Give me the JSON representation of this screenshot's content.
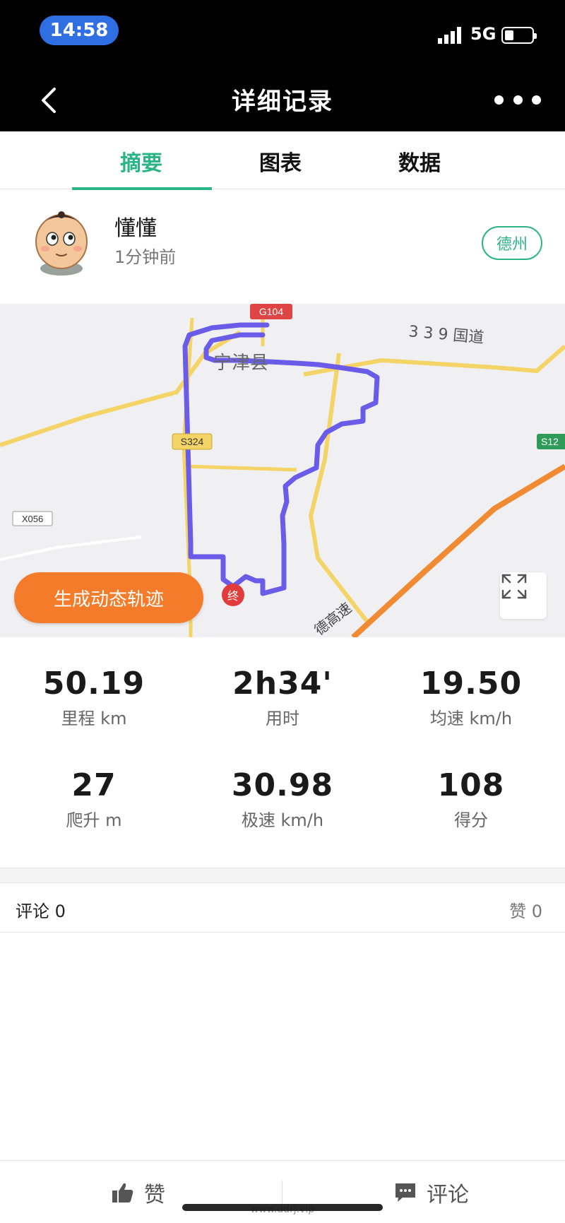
{
  "status_bar": {
    "time": "14:58",
    "network": "5G"
  },
  "header": {
    "title": "详细记录"
  },
  "tabs": [
    {
      "label": "摘要",
      "active": true
    },
    {
      "label": "图表",
      "active": false
    },
    {
      "label": "数据",
      "active": false
    }
  ],
  "user": {
    "name": "懂懂",
    "time_ago": "1分钟前",
    "city": "德州"
  },
  "map": {
    "labels": {
      "g104": "G104",
      "ningjin": "宁津县",
      "route339": "3 3 9 国道",
      "s324": "S324",
      "s12": "S12",
      "x056": "X056",
      "highway": "德高速",
      "end_marker": "终"
    },
    "generate_button": "生成动态轨迹",
    "colors": {
      "track": "#6a5ce8",
      "expressway": "#f08a33",
      "road": "#f4d466",
      "accent": "#2bb486"
    }
  },
  "stats": [
    {
      "value": "50.19",
      "label": "里程 km"
    },
    {
      "value": "2h34'",
      "label": "用时"
    },
    {
      "value": "19.50",
      "label": "均速 km/h"
    },
    {
      "value": "27",
      "label": "爬升 m"
    },
    {
      "value": "30.98",
      "label": "极速 km/h"
    },
    {
      "value": "108",
      "label": "得分"
    }
  ],
  "social": {
    "comments": "评论 0",
    "likes": "赞 0"
  },
  "bottom_bar": {
    "like_label": "赞",
    "comment_label": "评论"
  },
  "watermark": "www.ddrj.vip"
}
